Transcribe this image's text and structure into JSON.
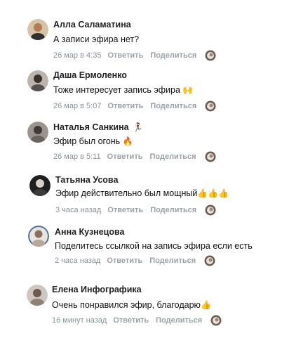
{
  "comments": [
    {
      "author": "Алла Саламатина",
      "author_emoji": "",
      "text": "А записи эфира нет?",
      "text_emoji": "",
      "time": "26 мар в 4:35",
      "reply": "Ответить",
      "share": "Поделиться",
      "avatar_color": "#c9a27a"
    },
    {
      "author": "Даша Ермоленко",
      "author_emoji": "",
      "text": "Тоже интересует запись эфира",
      "text_emoji": "🙌",
      "time": "26 мар в 5:07",
      "reply": "Ответить",
      "share": "Поделиться",
      "avatar_color": "#7a6f6a"
    },
    {
      "author": "Наталья Санкина",
      "author_emoji": "🏃‍♀️",
      "text": "Эфир был огонь",
      "text_emoji": "🔥",
      "time": "26 мар в 5:11",
      "reply": "Ответить",
      "share": "Поделиться",
      "avatar_color": "#5b5550"
    },
    {
      "author": "Татьяна Усова",
      "author_emoji": "",
      "text": "Эфир действительно был мощный",
      "text_emoji": "👍👍👍",
      "time": "3 часа назад",
      "reply": "Ответить",
      "share": "Поделиться",
      "avatar_color": "#2a2a2a"
    },
    {
      "author": "Анна Кузнецова",
      "author_emoji": "",
      "text": "Поделитесь ссылкой на запись эфира если есть",
      "text_emoji": "",
      "time": "2 часа назад",
      "reply": "Ответить",
      "share": "Поделиться",
      "avatar_color": "#6e8fb2"
    },
    {
      "author": "Елена Инфографика",
      "author_emoji": "",
      "text": "Очень понравился эфир, благодарю",
      "text_emoji": "👍",
      "time": "16 минут назад",
      "reply": "Ответить",
      "share": "Поделиться",
      "avatar_color": "#8a7b70"
    }
  ]
}
